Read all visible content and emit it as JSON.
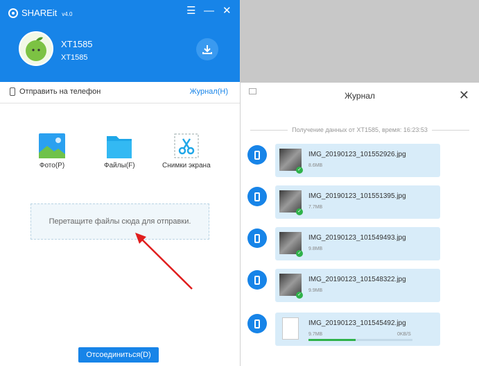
{
  "app": {
    "title": "SHAREit",
    "version": "v4.0"
  },
  "window_controls": {
    "menu": "☰",
    "minimize": "—",
    "close": "✕"
  },
  "user": {
    "name": "XT1585",
    "device": "XT1585"
  },
  "toolbar": {
    "send_label": "Отправить на телефон",
    "journal_label": "Журнал(H)"
  },
  "tiles": [
    {
      "label": "Фото(P)",
      "icon": "photo-icon"
    },
    {
      "label": "Файлы(F)",
      "icon": "folder-icon"
    },
    {
      "label": "Снимки экрана",
      "icon": "scissors-icon"
    }
  ],
  "drop_text": "Перетащите файлы сюда для отправки.",
  "disconnect_label": "Отсоединиться(D)",
  "journal": {
    "title": "Журнал",
    "close": "✕",
    "receive_header": "Получение данных от XT1585, время: 16:23:53",
    "items": [
      {
        "name": "IMG_20190123_101552926.jpg",
        "size": "8.6MB"
      },
      {
        "name": "IMG_20190123_101551395.jpg",
        "size": "7.7MB"
      },
      {
        "name": "IMG_20190123_101549493.jpg",
        "size": "9.8MB"
      },
      {
        "name": "IMG_20190123_101548322.jpg",
        "size": "9.9MB"
      },
      {
        "name": "IMG_20190123_101545492.jpg",
        "size": "9.7MB",
        "speed": "0KB/S",
        "progress": 0.45
      }
    ]
  },
  "colors": {
    "accent": "#1784e8",
    "bubble": "#d8ecf9",
    "success": "#2fb24a"
  }
}
